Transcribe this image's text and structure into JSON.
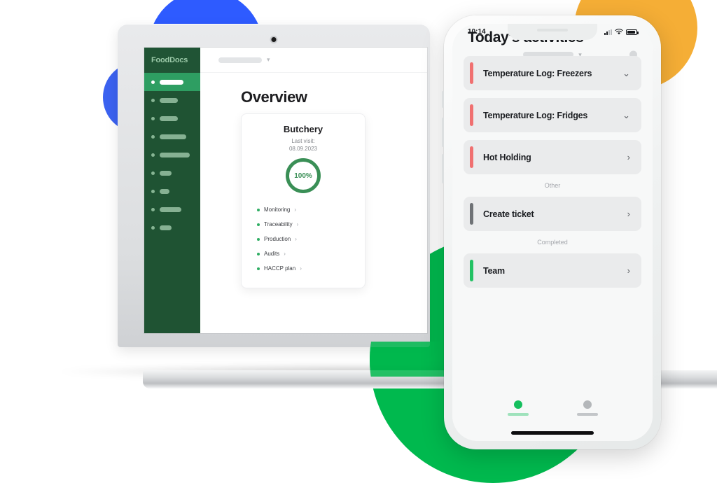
{
  "palette": {
    "blue": "#2E5BFF",
    "orange": "#F5AE36",
    "green": "#00B94E",
    "sidebar_green": "#1F5333",
    "active_green": "#2E9E62",
    "ring_green": "#3A8F56",
    "accent_red": "#F07070",
    "accent_grey": "#6F7276",
    "accent_green": "#23C264"
  },
  "laptop": {
    "app": {
      "logo": "FoodDocs",
      "topbar": {
        "account_placeholder": "",
        "chevron_icon": "chevron-down-icon"
      },
      "sidebar_items": [
        {
          "width": 34,
          "active": true
        },
        {
          "width": 26,
          "active": false
        },
        {
          "width": 26,
          "active": false
        },
        {
          "width": 38,
          "active": false
        },
        {
          "width": 43,
          "active": false
        },
        {
          "width": 17,
          "active": false
        },
        {
          "width": 14,
          "active": false
        },
        {
          "width": 31,
          "active": false
        },
        {
          "width": 17,
          "active": false
        }
      ],
      "page_title": "Overview",
      "facility_card": {
        "name": "Butchery",
        "visit_label": "Last visit:",
        "visit_date": "08.09.2023",
        "progress_value": "100%",
        "progress_percent": 100,
        "links": [
          {
            "label": "Monitoring",
            "arrow": "›"
          },
          {
            "label": "Traceability",
            "arrow": "›"
          },
          {
            "label": "Production",
            "arrow": "›"
          },
          {
            "label": "Audits",
            "arrow": "›"
          },
          {
            "label": "HACCP plan",
            "arrow": "›"
          }
        ]
      }
    }
  },
  "phone": {
    "status_bar": {
      "time": "10:14",
      "signal_icon": "cellular-signal-icon",
      "wifi_icon": "wifi-icon",
      "battery_icon": "battery-icon"
    },
    "app_bar": {
      "title_placeholder": "",
      "chevron_icon": "chevron-down-icon",
      "avatar_icon": "avatar-icon"
    },
    "heading": "Today's activities",
    "groups": [
      {
        "section_label": null,
        "items": [
          {
            "label": "Temperature Log: Freezers",
            "accent": "#F07070",
            "chevron": "⌄",
            "chevron_icon": "chevron-down-icon"
          },
          {
            "label": "Temperature Log: Fridges",
            "accent": "#F07070",
            "chevron": "⌄",
            "chevron_icon": "chevron-down-icon"
          },
          {
            "label": "Hot Holding",
            "accent": "#F07070",
            "chevron": "›",
            "chevron_icon": "chevron-right-icon"
          }
        ]
      },
      {
        "section_label": "Other",
        "items": [
          {
            "label": "Create ticket",
            "accent": "#6F7276",
            "chevron": "›",
            "chevron_icon": "chevron-right-icon"
          }
        ]
      },
      {
        "section_label": "Completed",
        "items": [
          {
            "label": "Team",
            "accent": "#23C264",
            "chevron": "›",
            "chevron_icon": "chevron-right-icon"
          }
        ]
      }
    ],
    "tabs": [
      {
        "icon": "home-tab-icon",
        "active": true,
        "glyph_color": "#15BF5E",
        "underline_color": "#9FE2BC"
      },
      {
        "icon": "profile-tab-icon",
        "active": false,
        "glyph_color": "#b4b7ba",
        "underline_color": "#c3c6c9"
      }
    ],
    "home_indicator": "home-indicator"
  }
}
